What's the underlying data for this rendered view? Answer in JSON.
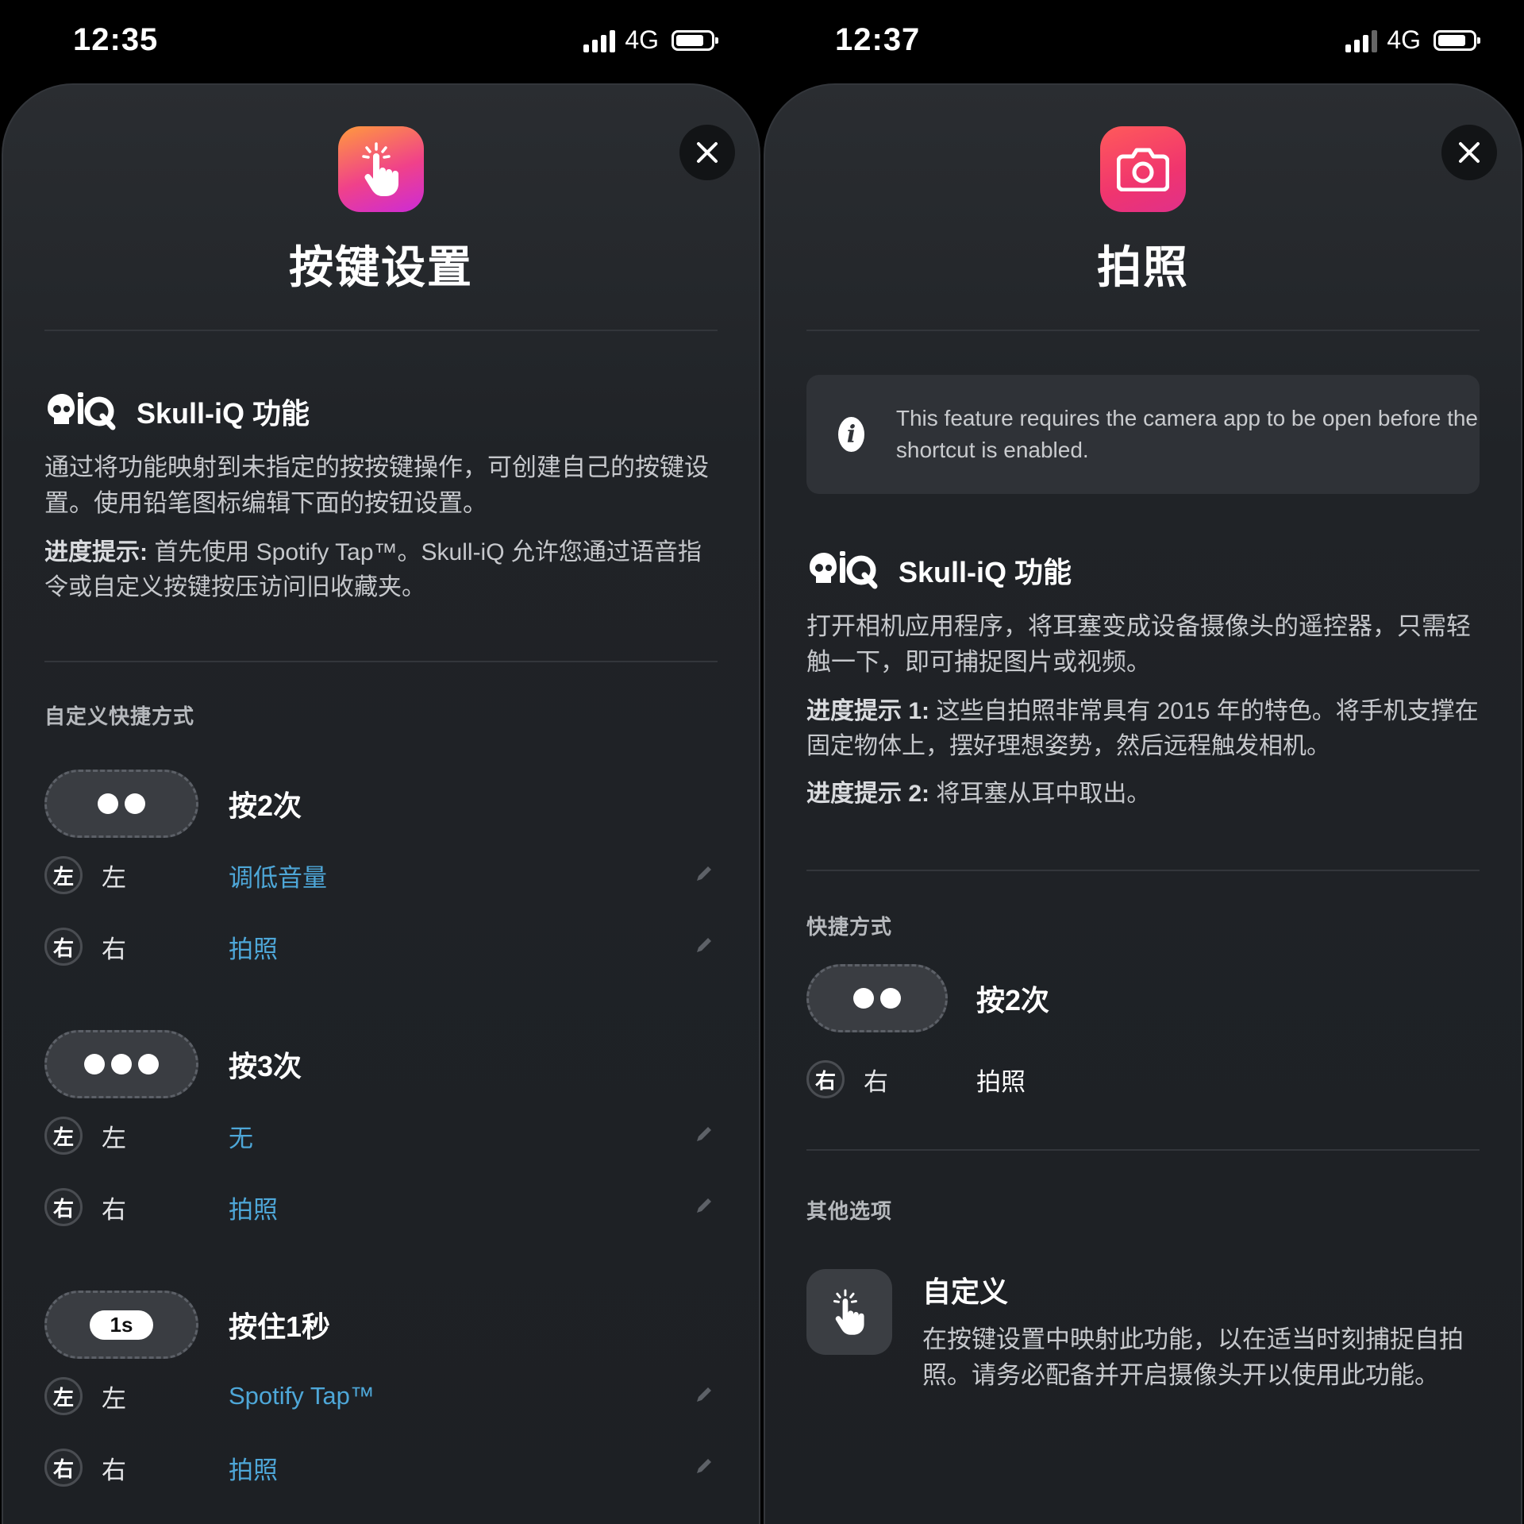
{
  "left": {
    "status": {
      "time": "12:35",
      "network": "4G"
    },
    "title": "按键设置",
    "iq": {
      "title": "Skull-iQ 功能",
      "description": "通过将功能映射到未指定的按按键操作，可创建自己的按键设置。使用铅笔图标编辑下面的按钮设置。",
      "tip_label": "进度提示:",
      "tip_text": " 首先使用 Spotify Tap™。Skull-iQ 允许您通过语音指令或自定义按键按压访问旧收藏夹。"
    },
    "section_label": "自定义快捷方式",
    "shortcuts": [
      {
        "title": "按2次",
        "rows": [
          {
            "badge": "左",
            "side": "左",
            "action": "调低音量"
          },
          {
            "badge": "右",
            "side": "右",
            "action": "拍照"
          }
        ]
      },
      {
        "title": "按3次",
        "rows": [
          {
            "badge": "左",
            "side": "左",
            "action": "无"
          },
          {
            "badge": "右",
            "side": "右",
            "action": "拍照"
          }
        ]
      },
      {
        "title": "按住1秒",
        "pill_label": "1s",
        "rows": [
          {
            "badge": "左",
            "side": "左",
            "action": "Spotify Tap™"
          },
          {
            "badge": "右",
            "side": "右",
            "action": "拍照"
          }
        ]
      }
    ]
  },
  "right": {
    "status": {
      "time": "12:37",
      "network": "4G"
    },
    "title": "拍照",
    "info": "This feature requires the camera app to be open before the shortcut is enabled.",
    "iq": {
      "title": "Skull-iQ 功能",
      "description": "打开相机应用程序，将耳塞变成设备摄像头的遥控器，只需轻触一下，即可捕捉图片或视频。",
      "tip1_label": "进度提示 1:",
      "tip1_text": " 这些自拍照非常具有 2015 年的特色。将手机支撑在固定物体上，摆好理想姿势，然后远程触发相机。",
      "tip2_label": "进度提示 2:",
      "tip2_text": " 将耳塞从耳中取出。"
    },
    "shortcut_label": "快捷方式",
    "shortcut": {
      "title": "按2次",
      "badge": "右",
      "side": "右",
      "action": "拍照"
    },
    "other_label": "其他选项",
    "other": {
      "title": "自定义",
      "description": "在按键设置中映射此功能，以在适当时刻捕捉自拍照。请务必配备并开启摄像头开以使用此功能。"
    }
  },
  "colors": {
    "accent": "#4ea7d8",
    "sheet": "#202327"
  },
  "icons": [
    "tap-hand-icon",
    "camera-icon",
    "close-icon",
    "skull-iq-logo",
    "pencil-icon",
    "info-icon"
  ]
}
